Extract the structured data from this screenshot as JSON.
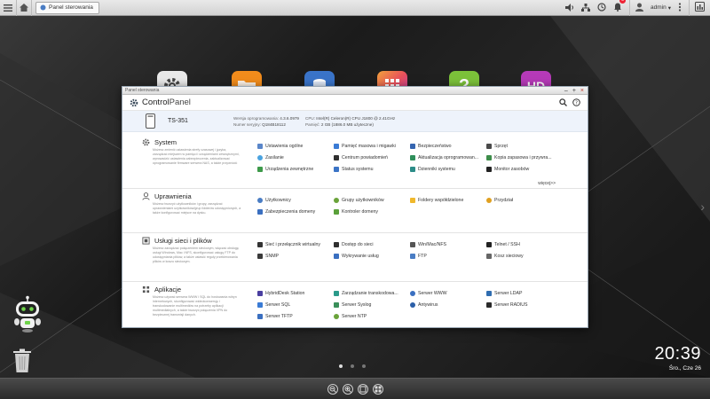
{
  "taskbar": {
    "tab_label": "Panel sterowania",
    "notification_count": "8",
    "user": "admin"
  },
  "window": {
    "title": "Panel sterowania",
    "brand_bold": "Control",
    "brand_light": "Panel",
    "device": {
      "name": "TS-351",
      "fw_label": "Wersja oprogramowania:",
      "fw_value": "4.3.6.0979",
      "serial_label": "Numer seryjny:",
      "serial_value": "Q184B18112",
      "cpu_label": "CPU:",
      "cpu_value": "Intel(R) Celeron(R) CPU J1800 @ 2.41GHz",
      "mem_label": "Pamięć:",
      "mem_value": "2 GB (1886.0 MB użyteczne)"
    },
    "sections": [
      {
        "title": "System",
        "desc": "Możesz zmienić ustawienia strefy czasowej i języka, zarządzać miejscem w pamięci i urządzeniami zewnętrznymi, wprowadzić ustawienia zabezpieczenia, zaktualizować oprogramowanie firmware serwera NAS, a także przywrócić",
        "more": "więcej>>",
        "items": [
          {
            "label": "Ustawienia ogólne",
            "color": "#5a86c9"
          },
          {
            "label": "Pamięć masowa i migawki",
            "color": "#3a7bd5"
          },
          {
            "label": "Bezpieczeństwo",
            "color": "#3565b0"
          },
          {
            "label": "Sprzęt",
            "color": "#4a4a4a"
          },
          {
            "label": "Zasilanie",
            "color": "#4aa3e0"
          },
          {
            "label": "Centrum powiadomień",
            "color": "#2f2f2f"
          },
          {
            "label": "Aktualizacja oprogramowan...",
            "color": "#2f8f5b"
          },
          {
            "label": "Kopia zapasowa i przywra...",
            "color": "#3d8d4a"
          },
          {
            "label": "Urządzenia zewnętrzne",
            "color": "#3d9a4a"
          },
          {
            "label": "Status systemu",
            "color": "#3b74c6"
          },
          {
            "label": "Dzienniki systemu",
            "color": "#2c8c88"
          },
          {
            "label": "Monitor zasobów",
            "color": "#222222"
          }
        ]
      },
      {
        "title": "Uprawnienia",
        "desc": "Możesz tworzyć użytkowników i grupy, zarządzać uprawnieniami użytkowników/grup folderów udostępnionych, a także konfigurować miejsce na dysku.",
        "items": [
          {
            "label": "Użytkownicy",
            "color": "#4a7dc4"
          },
          {
            "label": "Grupy użytkowników",
            "color": "#6aa33a"
          },
          {
            "label": "Foldery współdzielone",
            "color": "#f0b82c"
          },
          {
            "label": "Przydział",
            "color": "#e0a020"
          },
          {
            "label": "Zabezpieczenia domeny",
            "color": "#3a6fc0"
          },
          {
            "label": "Kontroler domeny",
            "color": "#5aa03a"
          }
        ]
      },
      {
        "title": "Usługi sieci i plików",
        "desc": "Możesz zarządzać połączeniem sieciowym, włączać obsługę usługi Windows, Mac i NFS, skonfigurować usługę FTP do udostępniania plików, a także ustawić reguły przekierowania plików w koszu sieciowym.",
        "items": [
          {
            "label": "Sieć i przełącznik wirtualny",
            "color": "#333333"
          },
          {
            "label": "Dostęp do sieci",
            "color": "#2f2f2f"
          },
          {
            "label": "Win/Mac/NFS",
            "color": "#555555"
          },
          {
            "label": "Telnet / SSH",
            "color": "#222222"
          },
          {
            "label": "SNMP",
            "color": "#3a3a3a"
          },
          {
            "label": "Wykrywanie usług",
            "color": "#3a6fc0"
          },
          {
            "label": "FTP",
            "color": "#4a7dc4"
          },
          {
            "label": "Kosz sieciowy",
            "color": "#666666"
          }
        ]
      },
      {
        "title": "Aplikacje",
        "desc": "Możesz używać serwera WWW i SQL do hostowania witryn internetowych, skonfigurować wideokonwersję i transkodowanie multimediów na potrzeby aplikacji multimedialnych, a także tworzyć połączenia VPN do bezpiecznej transmisji danych.",
        "items": [
          {
            "label": "HybridDesk Station",
            "color": "#4a3fa0"
          },
          {
            "label": "Zarządzanie transkodowa...",
            "color": "#2a9a8a"
          },
          {
            "label": "Serwer WWW",
            "color": "#3a6fc0"
          },
          {
            "label": "Serwer LDAP",
            "color": "#2f6db0"
          },
          {
            "label": "Serwer SQL",
            "color": "#3a7bd5"
          },
          {
            "label": "Serwer Syslog",
            "color": "#3a8f5a"
          },
          {
            "label": "Antywirus",
            "color": "#2c5fa8"
          },
          {
            "label": "Serwer RADIUS",
            "color": "#2a2a2a"
          },
          {
            "label": "Serwer TFTP",
            "color": "#3a6fc0"
          },
          {
            "label": "Serwer NTP",
            "color": "#6aa33a"
          }
        ]
      }
    ]
  },
  "desktop": {
    "clock_time": "20:39",
    "clock_date": "Śro., Cze 26",
    "apps": [
      {
        "icon": "gear-app-icon",
        "color": "#e8e8e8"
      },
      {
        "icon": "folder-app-icon",
        "color": "#f28c1c"
      },
      {
        "icon": "storage-app-icon",
        "color": "#3a74c9"
      },
      {
        "icon": "appcenter-app-icon",
        "color": "#e8505b"
      },
      {
        "icon": "help-app-icon",
        "color": "#7cc23a"
      },
      {
        "icon": "hd-app-icon",
        "color": "#b63ab8"
      }
    ]
  }
}
